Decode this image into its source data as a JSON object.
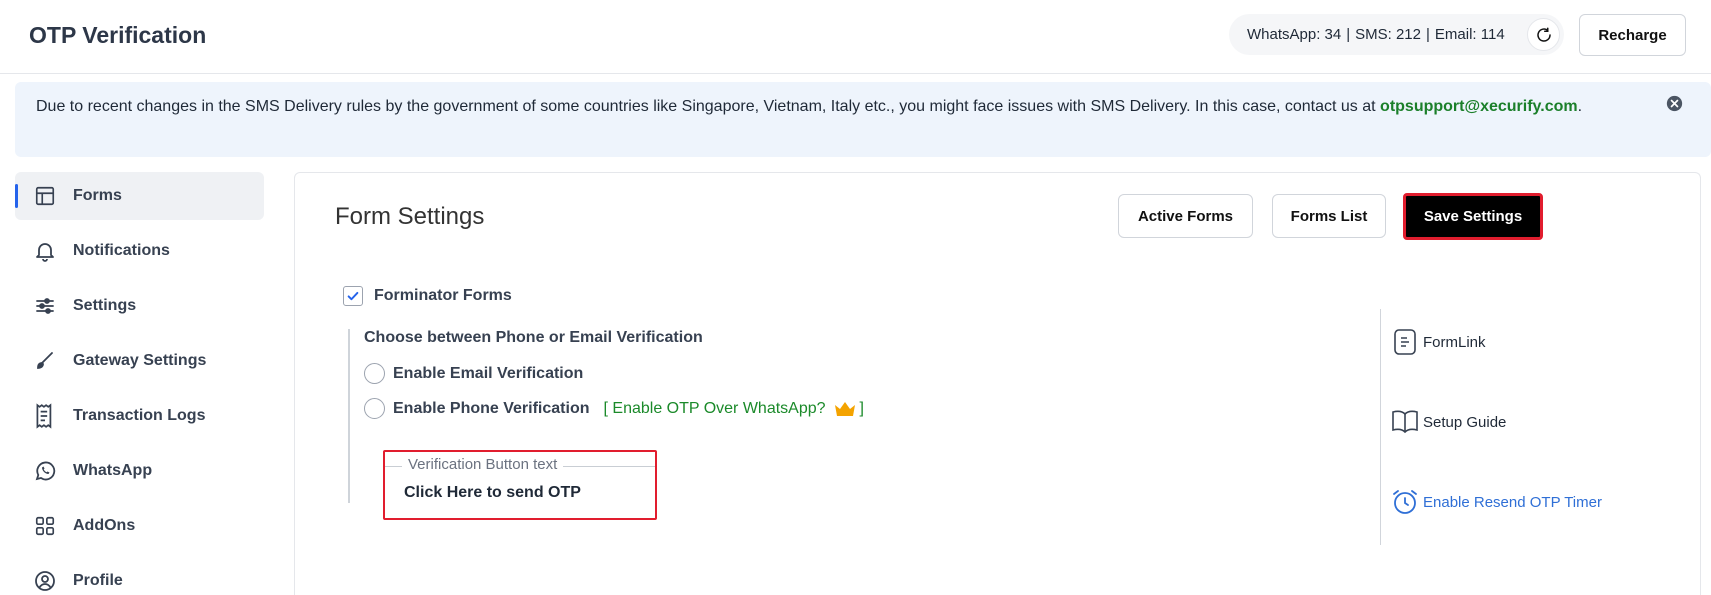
{
  "app": {
    "title": "OTP Verification"
  },
  "credits": {
    "whatsapp": "WhatsApp: 34",
    "sms": "SMS: 212",
    "email": "Email: 114",
    "separator": "|"
  },
  "topbar": {
    "recharge_label": "Recharge"
  },
  "notice": {
    "text": "Due to recent changes in the SMS Delivery rules by the government of some countries like Singapore, Vietnam, Italy etc., you might face issues with SMS Delivery. In this case, contact us at",
    "email": "otpsupport@xecurify.com",
    "end": "."
  },
  "sidebar": {
    "items": [
      {
        "label": "Forms",
        "icon": "layout-icon",
        "active": true
      },
      {
        "label": "Notifications",
        "icon": "bell-icon"
      },
      {
        "label": "Settings",
        "icon": "sliders-icon"
      },
      {
        "label": "Gateway Settings",
        "icon": "brush-icon"
      },
      {
        "label": "Transaction Logs",
        "icon": "receipt-icon"
      },
      {
        "label": "WhatsApp",
        "icon": "whatsapp-icon"
      },
      {
        "label": "AddOns",
        "icon": "grid-icon"
      },
      {
        "label": "Profile",
        "icon": "user-icon"
      }
    ]
  },
  "panel": {
    "title": "Form Settings",
    "active_forms_label": "Active Forms",
    "forms_list_label": "Forms List",
    "save_label": "Save Settings",
    "form_name": "Forminator Forms",
    "form_checked": true,
    "choose_label": "Choose between Phone or Email Verification",
    "email_option": "Enable Email Verification",
    "phone_option": "Enable Phone Verification",
    "whatsapp_open": "[ Enable OTP Over WhatsApp?",
    "whatsapp_close": "]",
    "vbtn_legend": "Verification Button text",
    "vbtn_value": "Click Here to send OTP"
  },
  "right_links": {
    "formlink": "FormLink",
    "setup_guide": "Setup Guide",
    "resend_timer": "Enable Resend OTP Timer"
  },
  "colors": {
    "accent_blue": "#2563eb",
    "link_green": "#1b7f2a",
    "highlight_red": "#e11d2e",
    "notice_bg": "#eef4fc"
  }
}
